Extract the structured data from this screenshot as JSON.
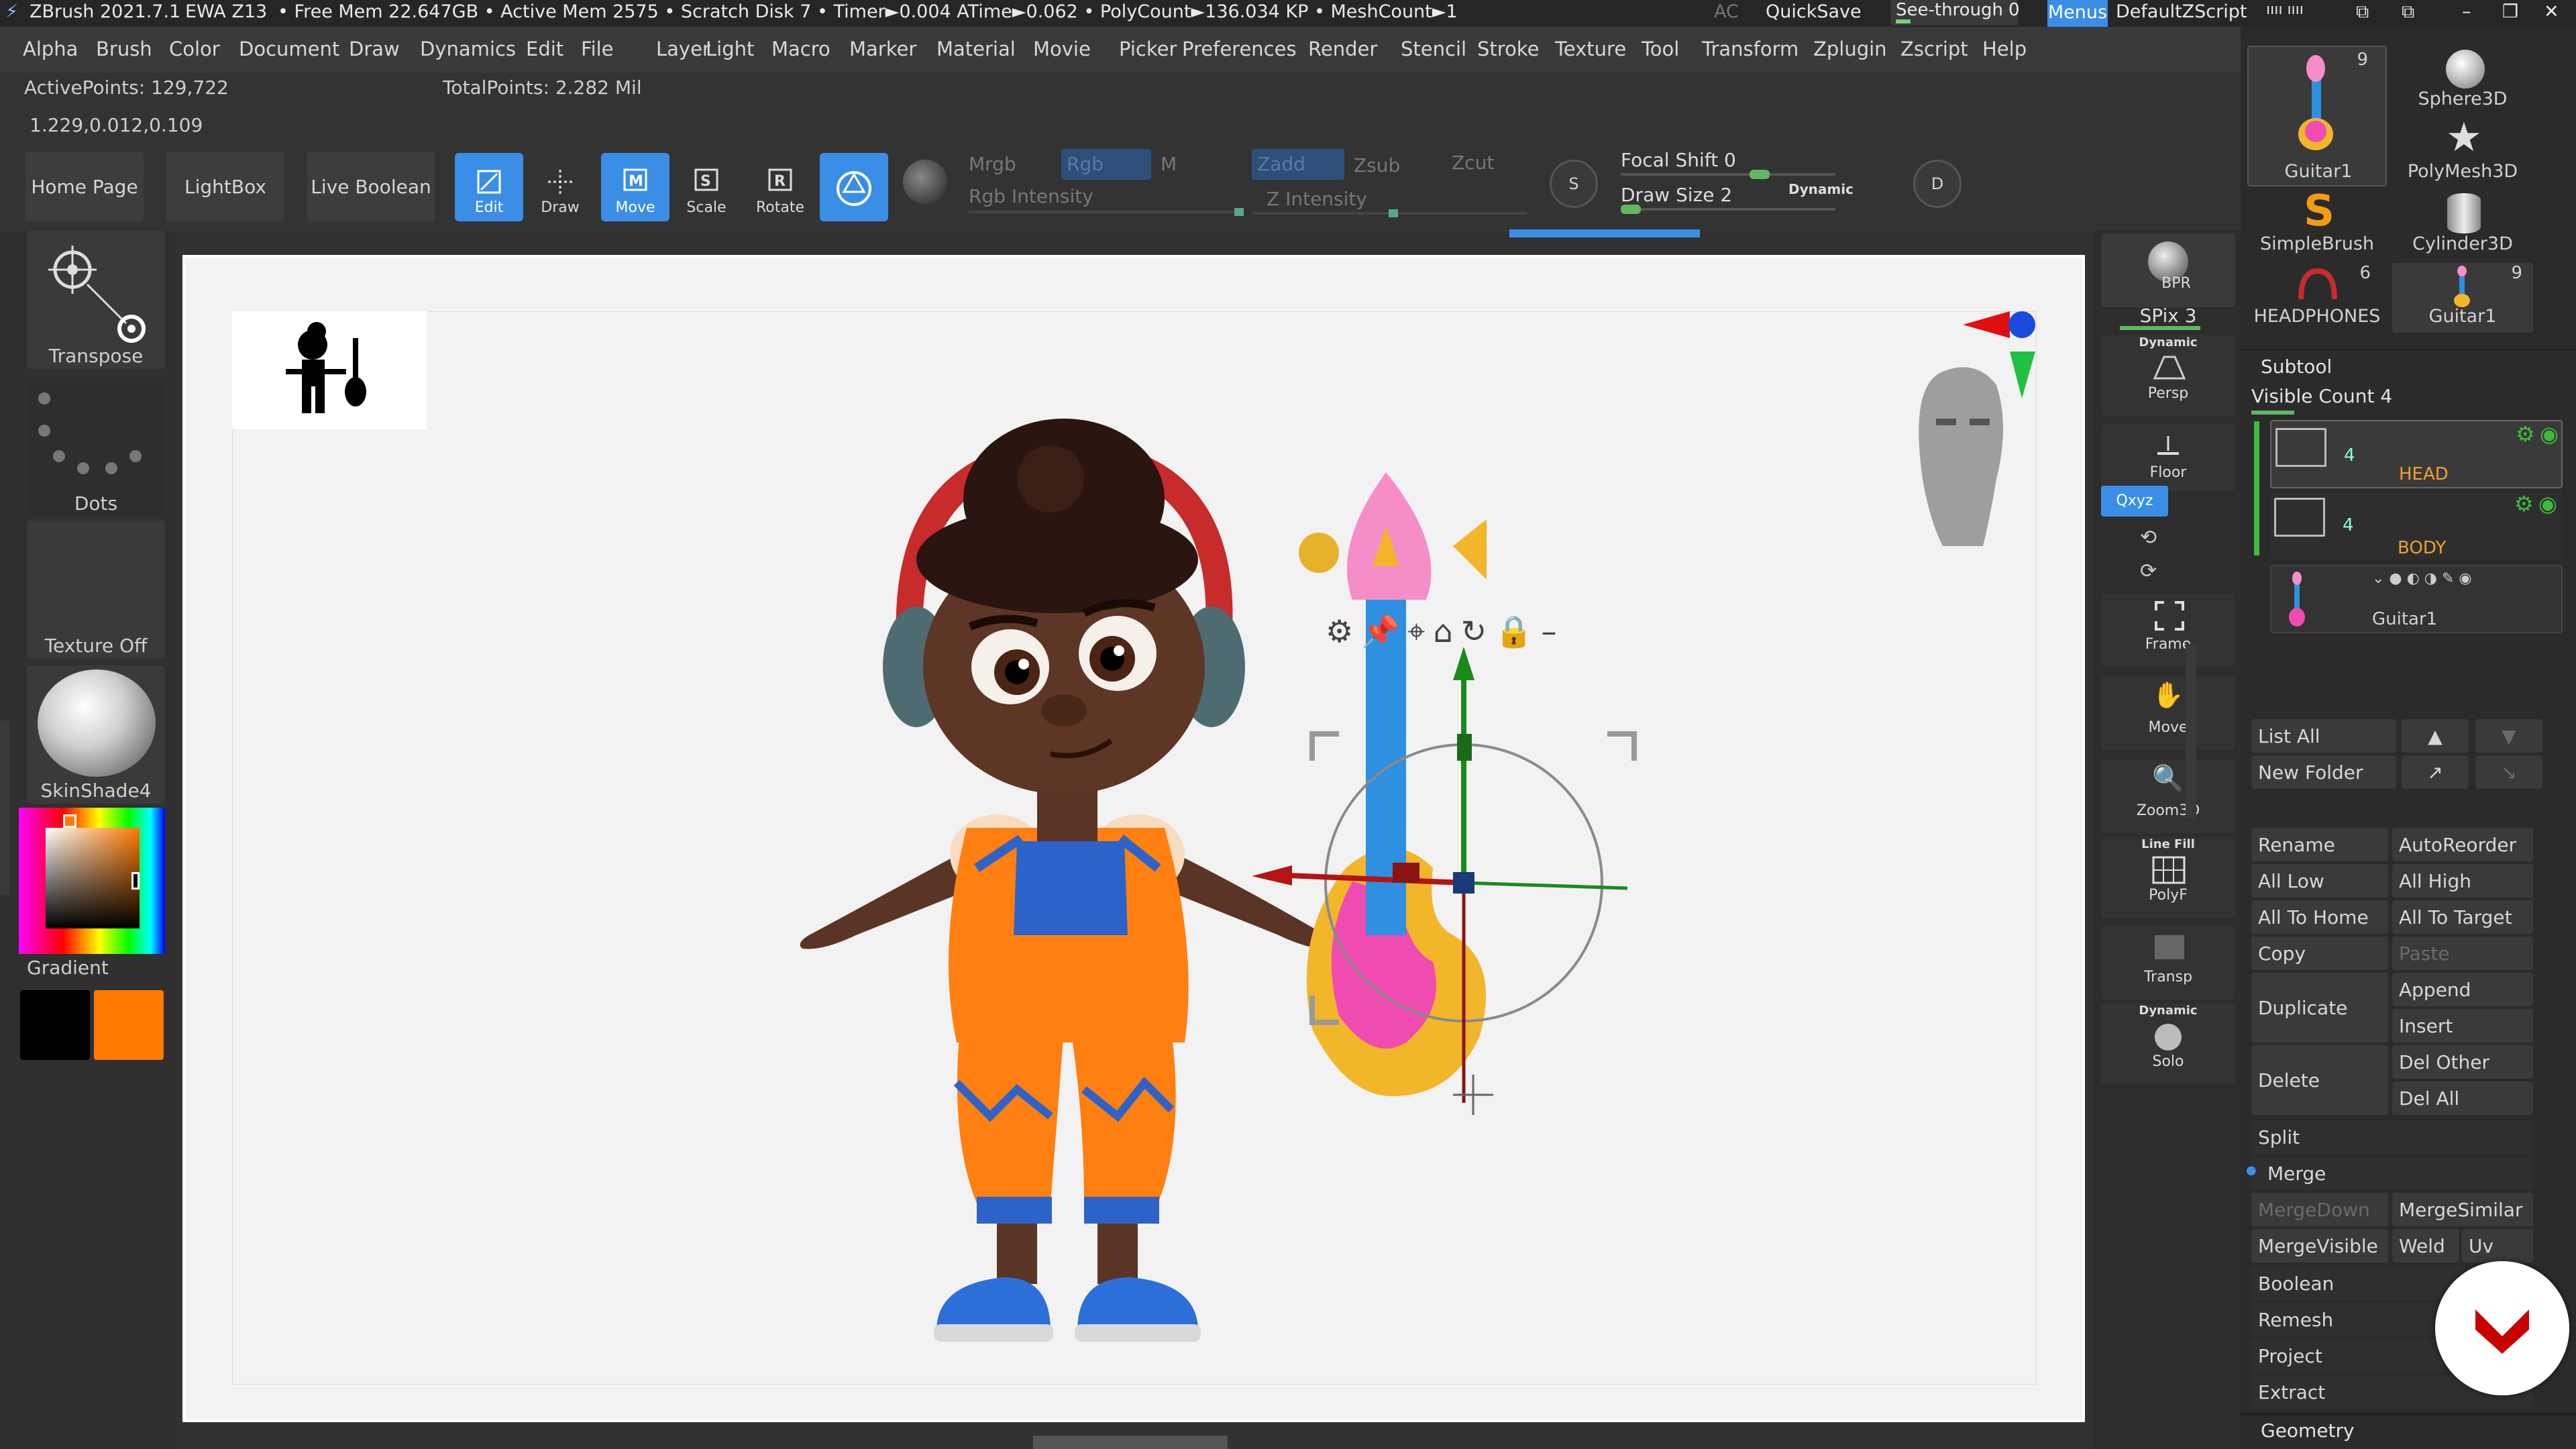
{
  "titlebar": {
    "app": "ZBrush 2021.7.1",
    "doc": "EWA Z13",
    "stats": "• Free Mem 22.647GB • Active Mem 2575 • Scratch Disk 7 • Timer►0.004 ATime►0.062 • PolyCount►136.034 KP • MeshCount►1",
    "ac": "AC",
    "quicksave": "QuickSave",
    "seethrough": "See-through",
    "seethrough_val": "0",
    "menus": "Menus",
    "script": "DefaultZScript"
  },
  "menu": [
    "Alpha",
    "Brush",
    "Color",
    "Document",
    "Draw",
    "Dynamics",
    "Edit",
    "File",
    "Layer",
    "Light",
    "Macro",
    "Marker",
    "Material",
    "Movie",
    "Picker",
    "Preferences",
    "Render",
    "Stencil",
    "Stroke",
    "Texture",
    "Tool",
    "Transform",
    "Zplugin",
    "Zscript",
    "Help"
  ],
  "info": {
    "active_points": "ActivePoints: 129,722",
    "total_points": "TotalPoints: 2.282 Mil",
    "coords": "1.229,0.012,0.109"
  },
  "toolbar": {
    "home": "Home Page",
    "lightbox": "LightBox",
    "live_boolean": "Live Boolean",
    "edit": "Edit",
    "draw": "Draw",
    "move": "Move",
    "scale": "Scale",
    "rotate": "Rotate",
    "mrgb": "Mrgb",
    "rgb": "Rgb",
    "m": "M",
    "rgb_intensity": "Rgb Intensity",
    "zadd": "Zadd",
    "zsub": "Zsub",
    "zcut": "Zcut",
    "z_intensity": "Z Intensity",
    "focal_shift": "Focal Shift 0",
    "draw_size": "Draw Size 2",
    "dynamic": "Dynamic",
    "s": "S",
    "d": "D"
  },
  "leftshelf": {
    "transpose": "Transpose",
    "dots": "Dots",
    "texture_off": "Texture Off",
    "material": "SkinShade4",
    "gradient": "Gradient",
    "colors": {
      "main": "#ff7a00",
      "secondary": "#000000"
    }
  },
  "rightshelf": {
    "bpr": "BPR",
    "spix": "SPix 3",
    "persp_top": "Dynamic",
    "persp": "Persp",
    "floor": "Floor",
    "xyz": "Qxyz",
    "frame": "Frame",
    "move": "Move",
    "zoom": "Zoom3D",
    "linefill": "Line Fill",
    "polyf": "PolyF",
    "transp": "Transp",
    "solo_top": "Dynamic",
    "solo": "Solo"
  },
  "tools": [
    {
      "name": "Guitar1",
      "count": "9"
    },
    {
      "name": "Sphere3D",
      "count": ""
    },
    {
      "name": "PolyMesh3D",
      "count": ""
    },
    {
      "name": "SimpleBrush",
      "count": ""
    },
    {
      "name": "Cylinder3D",
      "count": ""
    },
    {
      "name": "HEADPHONES",
      "count": "6"
    },
    {
      "name": "Guitar1",
      "count": "9"
    }
  ],
  "subtool": {
    "title": "Subtool",
    "visible_count": "Visible Count 4",
    "items": [
      {
        "name": "HEAD",
        "count": "4"
      },
      {
        "name": "BODY",
        "count": "4"
      },
      {
        "name": "Guitar1",
        "count": ""
      }
    ],
    "list_all": "List All",
    "new_folder": "New Folder",
    "rename": "Rename",
    "autoreorder": "AutoReorder",
    "all_low": "All Low",
    "all_high": "All High",
    "all_to_home": "All To Home",
    "all_to_target": "All To Target",
    "copy": "Copy",
    "paste": "Paste",
    "duplicate": "Duplicate",
    "append": "Append",
    "insert": "Insert",
    "delete": "Delete",
    "del_other": "Del Other",
    "del_all": "Del All",
    "split": "Split",
    "merge": "Merge",
    "mergedown": "MergeDown",
    "mergesimilar": "MergeSimilar",
    "mergevisible": "MergeVisible",
    "weld": "Weld",
    "uv": "Uv",
    "boolean": "Boolean",
    "remesh": "Remesh",
    "project": "Project",
    "extract": "Extract",
    "geometry": "Geometry"
  }
}
